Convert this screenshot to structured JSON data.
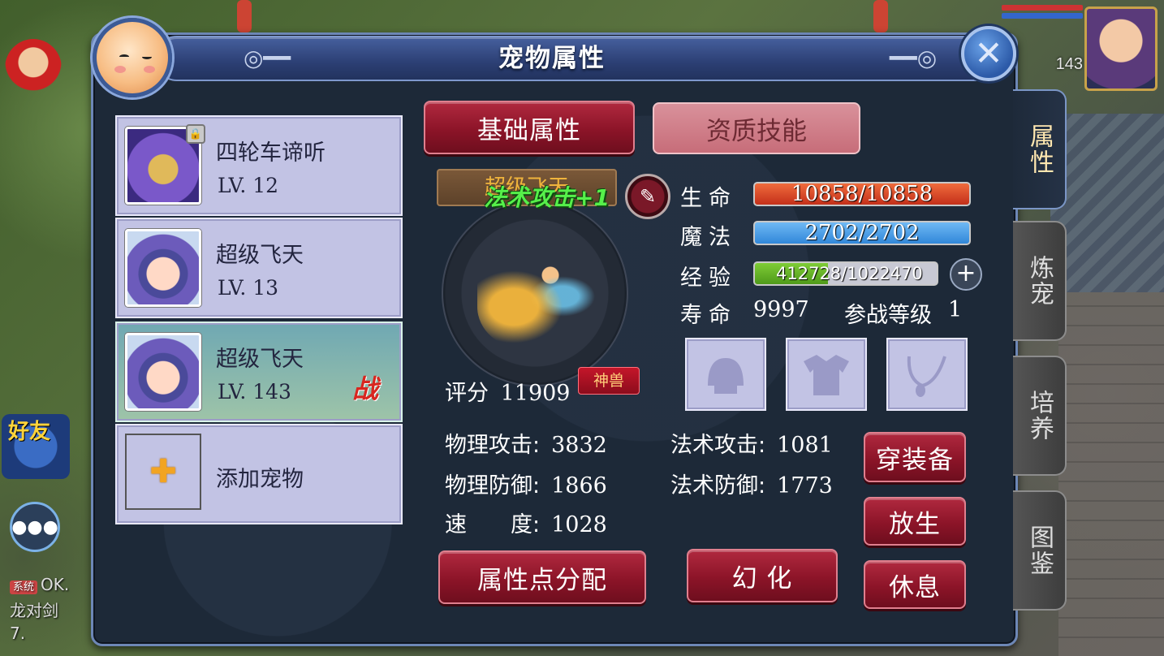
{
  "hud": {
    "level_badge": "143",
    "friend_label": "好友",
    "chat_tag": "系统",
    "chat_lines": [
      "OK.",
      "龙对剑",
      "7."
    ]
  },
  "panel": {
    "title": "宠物属性",
    "close_icon": "close-icon"
  },
  "side_tabs": [
    {
      "label": "属性",
      "active": true
    },
    {
      "label": "炼宠",
      "active": false
    },
    {
      "label": "培养",
      "active": false
    },
    {
      "label": "图鉴",
      "active": false
    }
  ],
  "pets": [
    {
      "name": "四轮车谛听",
      "level": "LV. 12",
      "locked": true,
      "selected": false
    },
    {
      "name": "超级飞天",
      "level": "LV. 13",
      "selected": false
    },
    {
      "name": "超级飞天",
      "level": "LV. 143",
      "selected": true,
      "battle_badge": "战"
    }
  ],
  "add_pet": {
    "label": "添加宠物",
    "icon": "plus-icon"
  },
  "tabs": {
    "basic": "基础属性",
    "aptitude": "资质技能"
  },
  "pet_display": {
    "name_plate": "超级飞天",
    "buff": "法术攻击+1",
    "score_label": "评分",
    "score": "11909",
    "rank_badge": "神兽"
  },
  "stats": {
    "hp_label": "生命",
    "hp": "10858/10858",
    "mp_label": "魔法",
    "mp": "2702/2702",
    "exp_label": "经验",
    "exp": "412728/1022470",
    "exp_fraction": 0.4037,
    "life_label": "寿命",
    "life": "9997",
    "battle_level_label": "参战等级",
    "battle_level": "1"
  },
  "equipment": [
    "helmet-slot-icon",
    "armor-slot-icon",
    "necklace-slot-icon"
  ],
  "attributes": {
    "phys_atk_label": "物理攻击:",
    "phys_atk": "3832",
    "phys_def_label": "物理防御:",
    "phys_def": "1866",
    "speed_label": "速　　度:",
    "speed": "1028",
    "magic_atk_label": "法术攻击:",
    "magic_atk": "1081",
    "magic_def_label": "法术防御:",
    "magic_def": "1773"
  },
  "actions": {
    "equip": "穿装备",
    "release": "放生",
    "rest": "休息",
    "allocate": "属性点分配",
    "transform": "幻 化"
  },
  "colors": {
    "accent_red": "#8c1428",
    "hp_bar": "#e0512a",
    "mp_bar": "#4aa0ea",
    "exp_bar": "#66b526",
    "buff_green": "#56f04a"
  }
}
